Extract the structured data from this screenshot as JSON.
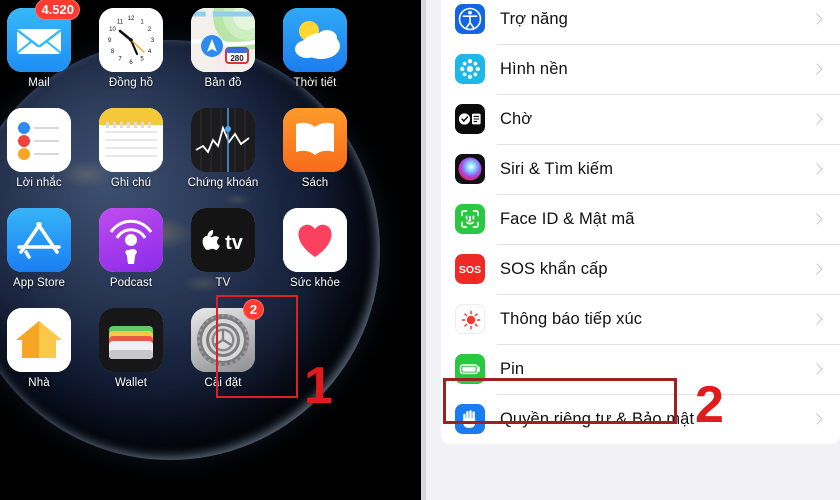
{
  "tutorial": {
    "step_markers": [
      {
        "number": "1",
        "panel": "home-screen"
      },
      {
        "number": "2",
        "panel": "settings-list"
      }
    ],
    "highlight_color": "#e01b1b"
  },
  "home_screen": {
    "wallpaper": "earth-from-space",
    "apps": [
      {
        "name": "Mail",
        "label": "Mail",
        "icon": "mail-icon",
        "badge": "4.520",
        "row": 1,
        "col": 1
      },
      {
        "name": "Clock",
        "label": "Đồng hồ",
        "icon": "clock-icon",
        "badge": null,
        "row": 1,
        "col": 2
      },
      {
        "name": "Maps",
        "label": "Bản đồ",
        "icon": "maps-icon",
        "badge": null,
        "row": 1,
        "col": 3
      },
      {
        "name": "Weather",
        "label": "Thời tiết",
        "icon": "weather-icon",
        "badge": null,
        "row": 1,
        "col": 4
      },
      {
        "name": "Reminders",
        "label": "Lời nhắc",
        "icon": "reminders-icon",
        "badge": null,
        "row": 2,
        "col": 1
      },
      {
        "name": "Notes",
        "label": "Ghi chú",
        "icon": "notes-icon",
        "badge": null,
        "row": 2,
        "col": 2
      },
      {
        "name": "Stocks",
        "label": "Chứng khoán",
        "icon": "stocks-icon",
        "badge": null,
        "row": 2,
        "col": 3
      },
      {
        "name": "Books",
        "label": "Sách",
        "icon": "books-icon",
        "badge": null,
        "row": 2,
        "col": 4
      },
      {
        "name": "AppStore",
        "label": "App Store",
        "icon": "app-store-icon",
        "badge": null,
        "row": 3,
        "col": 1
      },
      {
        "name": "Podcasts",
        "label": "Podcast",
        "icon": "podcast-icon",
        "badge": null,
        "row": 3,
        "col": 2
      },
      {
        "name": "TV",
        "label": "TV",
        "icon": "apple-tv-icon",
        "badge": null,
        "row": 3,
        "col": 3
      },
      {
        "name": "Health",
        "label": "Sức khỏe",
        "icon": "health-icon",
        "badge": null,
        "row": 3,
        "col": 4
      },
      {
        "name": "Home",
        "label": "Nhà",
        "icon": "home-app-icon",
        "badge": null,
        "row": 4,
        "col": 1
      },
      {
        "name": "Wallet",
        "label": "Wallet",
        "icon": "wallet-icon",
        "badge": null,
        "row": 4,
        "col": 2
      },
      {
        "name": "Settings",
        "label": "Cài đặt",
        "icon": "settings-gear-icon",
        "badge": "2",
        "row": 4,
        "col": 3
      }
    ],
    "highlighted_app": "Cài đặt",
    "step_number": "1"
  },
  "settings_list": {
    "rows": [
      {
        "label": "Trợ năng",
        "icon": "accessibility-icon",
        "icon_color": "#1267e0",
        "chevron": true
      },
      {
        "label": "Hình nền",
        "icon": "wallpaper-icon",
        "icon_color": "#1fb6e8",
        "chevron": true
      },
      {
        "label": "Chờ",
        "icon": "standby-icon",
        "icon_color": "#0b0b0b",
        "chevron": true
      },
      {
        "label": "Siri & Tìm kiếm",
        "icon": "siri-icon",
        "icon_color": "#101014",
        "chevron": true
      },
      {
        "label": "Face ID & Mật mã",
        "icon": "face-id-icon",
        "icon_color": "#28c840",
        "chevron": true
      },
      {
        "label": "SOS khẩn cấp",
        "icon": "sos-icon",
        "icon_color": "#ee2a26",
        "chevron": true
      },
      {
        "label": "Thông báo tiếp xúc",
        "icon": "exposure-notification-icon",
        "icon_color": "#ffffff",
        "chevron": true
      },
      {
        "label": "Pin",
        "icon": "battery-icon",
        "icon_color": "#28c840",
        "chevron": true
      },
      {
        "label": "Quyền riêng tư & Bảo mật",
        "icon": "privacy-hand-icon",
        "icon_color": "#1b7cf0",
        "chevron": true
      }
    ],
    "highlighted_row": "Pin",
    "step_number": "2"
  }
}
